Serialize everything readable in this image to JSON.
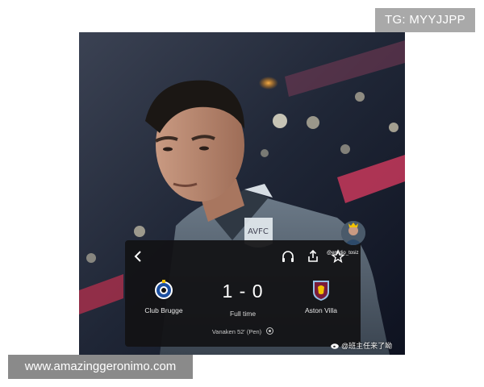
{
  "watermarks": {
    "tg_tag": "TG: MYYJJPP",
    "site_tag": "www.amazinggeronimo.com",
    "weibo_credit": "@班主任来了呦"
  },
  "user": {
    "handle": "@emidio_tosiz"
  },
  "match": {
    "home_team": "Club Brugge",
    "away_team": "Aston Villa",
    "score": "1 - 0",
    "status": "Full time",
    "scorer": "Vanaken 52' (Pen)"
  },
  "toolbar": {
    "icons": [
      "back-icon",
      "headphones-icon",
      "share-icon",
      "star-icon"
    ]
  },
  "colors": {
    "card_bg": "#121214",
    "tag_bg": "#a9a9a9",
    "site_tag_bg": "#8a8a8a",
    "villa_claret": "#7a1c3a",
    "villa_blue": "#95bfe5",
    "brugge_blue": "#1c4fa0"
  }
}
